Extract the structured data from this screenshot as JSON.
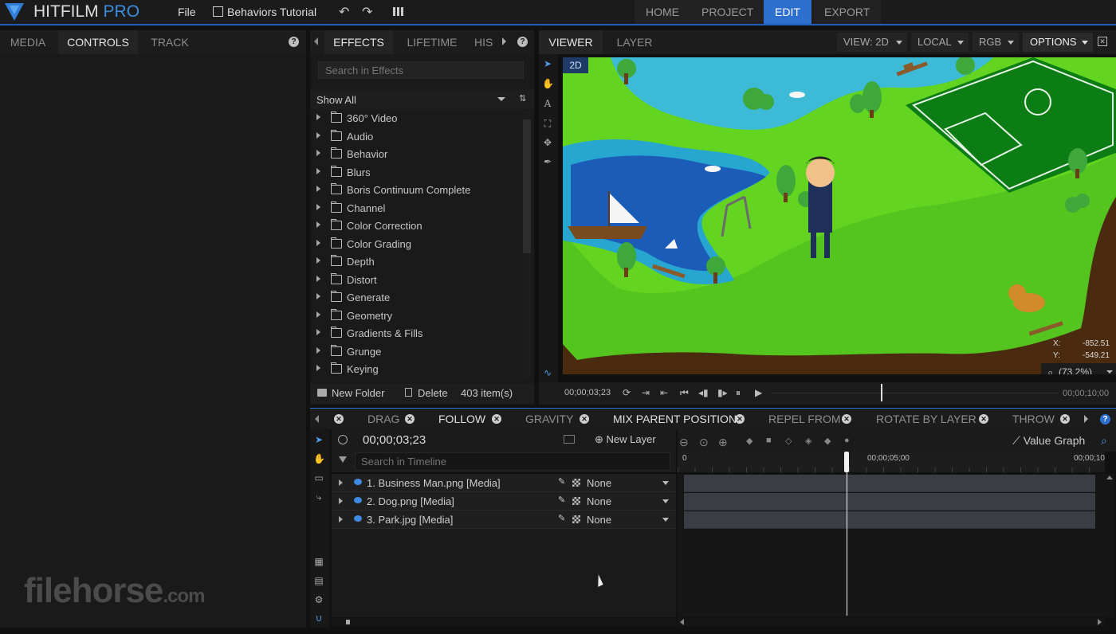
{
  "app": {
    "logo_main": "HITFILM",
    "logo_pro": "PRO",
    "menu_file": "File",
    "project_name": "Behaviors Tutorial"
  },
  "nav": {
    "tabs": [
      "HOME",
      "PROJECT",
      "EDIT",
      "EXPORT"
    ],
    "active": "EDIT"
  },
  "left_panel": {
    "tabs": [
      "MEDIA",
      "CONTROLS",
      "TRACK"
    ],
    "active": "CONTROLS",
    "help": "?"
  },
  "effects_panel": {
    "tabs": [
      "EFFECTS",
      "LIFETIME",
      "HIS"
    ],
    "active": "EFFECTS",
    "help": "?",
    "search_placeholder": "Search in Effects",
    "filter_value": "Show All",
    "items": [
      "360° Video",
      "Audio",
      "Behavior",
      "Blurs",
      "Boris Continuum Complete",
      "Channel",
      "Color Correction",
      "Color Grading",
      "Depth",
      "Distort",
      "Generate",
      "Geometry",
      "Gradients & Fills",
      "Grunge",
      "Keying"
    ],
    "new_folder": "New Folder",
    "delete": "Delete",
    "count": "403 item(s)"
  },
  "viewer": {
    "tabs": [
      "VIEWER",
      "LAYER"
    ],
    "active": "VIEWER",
    "view_select": "VIEW: 2D",
    "local_select": "LOCAL",
    "rgb_select": "RGB",
    "options": "OPTIONS",
    "badge_2d": "2D",
    "coord_x_label": "X:",
    "coord_x_value": "-852.51",
    "coord_y_label": "Y:",
    "coord_y_value": "-549.21",
    "zoom": "(73.2%)",
    "time_current": "00;00;03;23",
    "time_end": "00;00;10;00",
    "playhead_fraction": 0.38
  },
  "behaviors_bar": {
    "tabs": [
      "DRAG",
      "FOLLOW",
      "GRAVITY",
      "MIX PARENT POSITION",
      "REPEL FROM",
      "ROTATE BY LAYER",
      "THROW"
    ],
    "active_tabs": [
      "FOLLOW",
      "MIX PARENT POSITION"
    ],
    "help": "?"
  },
  "timeline": {
    "timecode": "00;00;03;23",
    "new_layer": "New Layer",
    "value_graph": "Value Graph",
    "search_placeholder": "Search in Timeline",
    "ruler": [
      "0",
      "00;00;05;00",
      "00;00;10"
    ],
    "layers": [
      {
        "name": "1. Business Man.png [Media]",
        "blend": "None"
      },
      {
        "name": "2. Dog.png [Media]",
        "blend": "None"
      },
      {
        "name": "3. Park.jpg [Media]",
        "blend": "None"
      }
    ]
  },
  "watermark": {
    "text": "filehorse",
    "suffix": ".com"
  },
  "colors": {
    "accent": "#2d6fcf",
    "grass": "#43c21a",
    "water": "#1b5fb8"
  }
}
